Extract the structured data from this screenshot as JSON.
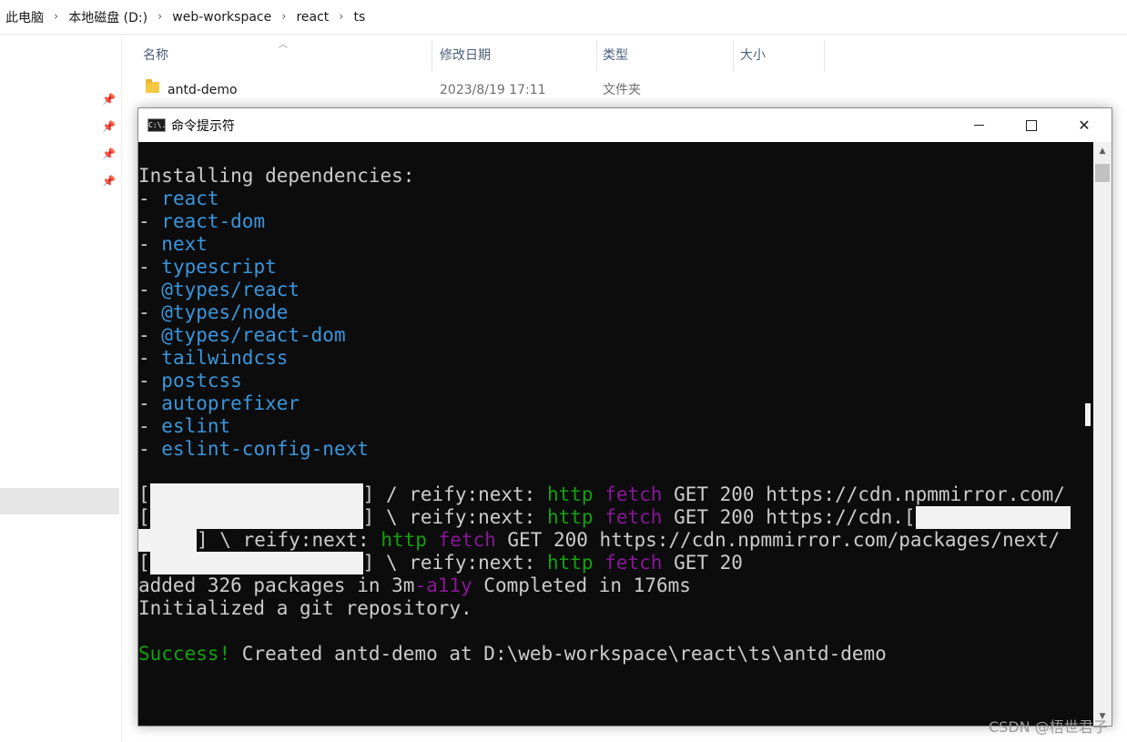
{
  "explorer": {
    "breadcrumb": [
      "此电脑",
      "本地磁盘 (D:)",
      "web-workspace",
      "react",
      "ts"
    ],
    "columns": {
      "name": "名称",
      "modified": "修改日期",
      "type": "类型",
      "size": "大小"
    },
    "files": [
      {
        "name": "antd-demo",
        "modified": "2023/8/19 17:11",
        "type": "文件夹",
        "size": ""
      }
    ]
  },
  "cmd": {
    "title": "命令提示符",
    "icon_label": "C:\\.",
    "buttons": {
      "minimize": "minimize-icon",
      "maximize": "maximize-icon",
      "close": "✕"
    },
    "header_line": "Installing dependencies:",
    "dep_prefix": "- ",
    "dependencies": [
      "react",
      "react-dom",
      "next",
      "typescript",
      "@types/react",
      "@types/node",
      "@types/react-dom",
      "tailwindcss",
      "postcss",
      "autoprefixer",
      "eslint",
      "eslint-config-next"
    ],
    "progress": {
      "bracket_open": "[",
      "bracket_close": "]",
      "spin1": " / reify:next: ",
      "spin2": " \\ reify:next: ",
      "http": "http",
      "fetch": "fetch",
      "get200_url1": " GET 200 https://cdn.npmmirror.com/",
      "get200_url2": " GET 200 https://cdn.[",
      "get200_url3": " GET 200 https://cdn.npmmirror.com/packages/next/",
      "get20": " GET 20",
      "sp": " "
    },
    "added_pre": "added 326 packages in 3m",
    "added_magenta": "-a11y",
    "added_post": " Completed in 176ms",
    "git_line": "Initialized a git repository.",
    "success_word": "Success!",
    "success_rest": " Created antd-demo at D:\\web-workspace\\react\\ts\\antd-demo"
  },
  "watermark": "CSDN @梧世君子",
  "colors": {
    "dep": "#3a96dd",
    "green": "#13a10e",
    "magenta": "#881798",
    "console_bg": "#0c0c0c"
  }
}
